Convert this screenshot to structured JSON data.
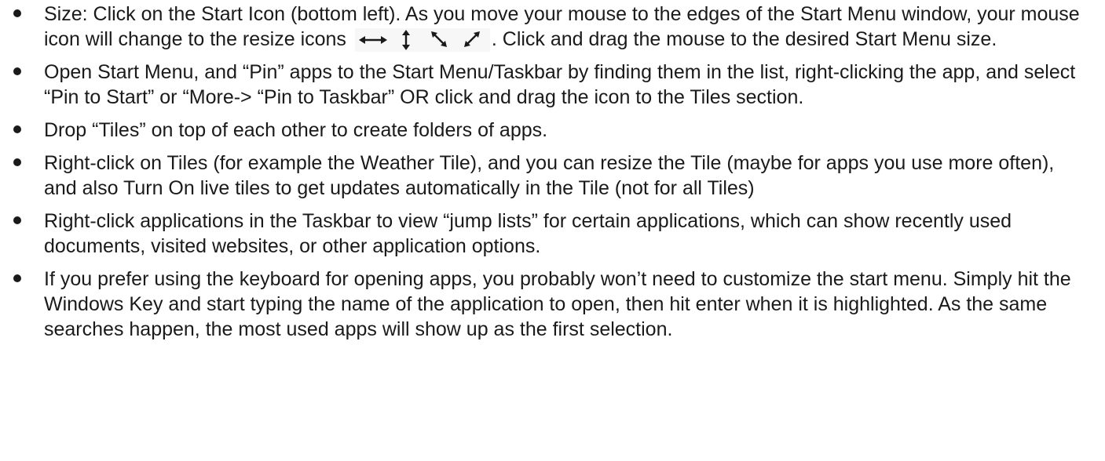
{
  "bullets": [
    {
      "before": "Size: Click on the Start Icon (bottom left). As you move your mouse to the edges of the Start Menu window, your mouse icon will change to the resize icons ",
      "after": ". Click and drag the mouse to the desired Start Menu size.",
      "icons": [
        "horizontal-resize-icon",
        "vertical-resize-icon",
        "diagonal-resize-nwse-icon",
        "diagonal-resize-nesw-icon"
      ]
    },
    {
      "text": "Open Start Menu, and “Pin” apps to the Start Menu/Taskbar by finding them in the list, right-clicking the app, and select “Pin to Start” or “More-> “Pin to Taskbar” OR click and drag the icon to the Tiles section."
    },
    {
      "text": "Drop “Tiles” on top of each other to create folders of apps."
    },
    {
      "text": "Right-click on Tiles (for example the Weather Tile), and you can resize the Tile (maybe for apps you use more often), and also Turn On live tiles to get updates automatically in the Tile (not for all Tiles)"
    },
    {
      "text": "Right-click applications in the Taskbar to view “jump lists” for certain applications, which can show recently used documents, visited websites, or other application options."
    },
    {
      "text": "If you prefer using the keyboard for opening apps, you probably won’t need to customize the start menu. Simply hit the Windows Key and start typing the name of the application to open, then hit enter when it is highlighted. As the same searches happen, the most used apps will show up as the first selection."
    }
  ],
  "colors": {
    "text": "#1a1a1a",
    "background": "#ffffff"
  }
}
